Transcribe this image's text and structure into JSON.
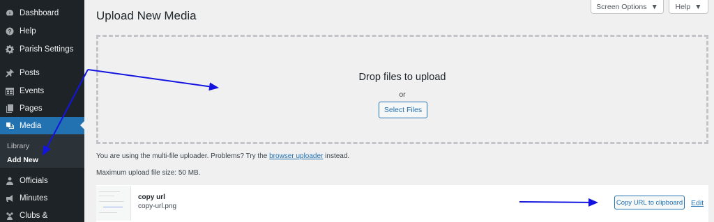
{
  "sidebar": {
    "items": [
      {
        "label": "Dashboard",
        "icon": "dashboard-icon"
      },
      {
        "label": "Help",
        "icon": "help-icon"
      },
      {
        "label": "Parish Settings",
        "icon": "gear-icon"
      },
      {
        "label": "Posts",
        "icon": "pin-icon"
      },
      {
        "label": "Events",
        "icon": "calendar-icon"
      },
      {
        "label": "Pages",
        "icon": "pages-icon"
      },
      {
        "label": "Media",
        "icon": "media-icon"
      },
      {
        "label": "Officials",
        "icon": "person-icon"
      },
      {
        "label": "Minutes",
        "icon": "megaphone-icon"
      },
      {
        "label": "Clubs &",
        "icon": "groups-icon"
      }
    ],
    "submenu": [
      {
        "label": "Library"
      },
      {
        "label": "Add New"
      }
    ]
  },
  "header": {
    "screen_options": "Screen Options",
    "help": "Help",
    "title": "Upload New Media"
  },
  "dropzone": {
    "title": "Drop files to upload",
    "or": "or",
    "select_button": "Select Files"
  },
  "info": {
    "uploader_prefix": "You are using the multi-file uploader. Problems? Try the",
    "uploader_link": "browser uploader",
    "uploader_suffix": "instead.",
    "max_size": "Maximum upload file size: 50 MB."
  },
  "file": {
    "title": "copy url",
    "filename": "copy-url.png",
    "copy_button": "Copy URL to clipboard",
    "edit_link": "Edit"
  },
  "colors": {
    "sidebar_bg": "#1d2327",
    "accent": "#2271b1",
    "annotation_arrow": "#1414e0"
  }
}
